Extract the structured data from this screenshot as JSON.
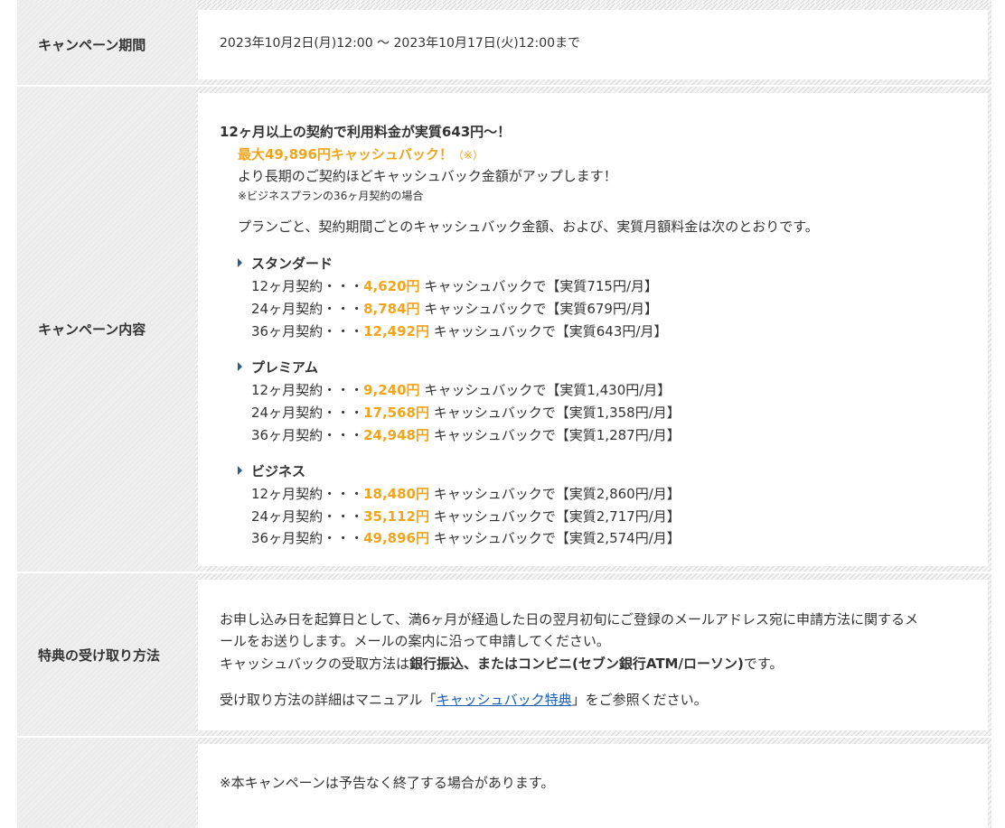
{
  "rows": [
    {
      "header": "キャンペーン期間",
      "period": "2023年10月2日(月)12:00 〜 2023年10月17日(火)12:00まで"
    },
    {
      "header": "キャンペーン内容",
      "headline": "12ヶ月以上の契約で利用料金が実質643円〜！",
      "max_cashback": "最大49,896円キャッシュバック！",
      "note_mark": "（※）",
      "longer_term": "より長期のご契約ほどキャッシュバック金額がアップします！",
      "footnote": "※ビジネスプランの36ヶ月契約の場合",
      "intro": "プランごと、契約期間ごとのキャッシュバック金額、および、実質月額料金は次のとおりです。",
      "plans": [
        {
          "name": "スタンダード",
          "rows": [
            {
              "term": "12ヶ月契約・・・",
              "amount": "4,620円",
              "suffix": " キャッシュバックで【実質715円/月】"
            },
            {
              "term": "24ヶ月契約・・・",
              "amount": "8,784円",
              "suffix": " キャッシュバックで【実質679円/月】"
            },
            {
              "term": "36ヶ月契約・・・",
              "amount": "12,492円",
              "suffix": " キャッシュバックで【実質643円/月】"
            }
          ]
        },
        {
          "name": "プレミアム",
          "rows": [
            {
              "term": "12ヶ月契約・・・",
              "amount": "9,240円",
              "suffix": " キャッシュバックで【実質1,430円/月】"
            },
            {
              "term": "24ヶ月契約・・・",
              "amount": "17,568円",
              "suffix": " キャッシュバックで【実質1,358円/月】"
            },
            {
              "term": "36ヶ月契約・・・",
              "amount": "24,948円",
              "suffix": " キャッシュバックで【実質1,287円/月】"
            }
          ]
        },
        {
          "name": "ビジネス",
          "rows": [
            {
              "term": "12ヶ月契約・・・",
              "amount": "18,480円",
              "suffix": " キャッシュバックで【実質2,860円/月】"
            },
            {
              "term": "24ヶ月契約・・・",
              "amount": "35,112円",
              "suffix": " キャッシュバックで【実質2,717円/月】"
            },
            {
              "term": "36ヶ月契約・・・",
              "amount": "49,896円",
              "suffix": " キャッシュバックで【実質2,574円/月】"
            }
          ]
        }
      ]
    },
    {
      "header": "特典の受け取り方法",
      "p1_line1": "お申し込み日を起算日として、満6ヶ月が経過した日の翌月初旬にご登録のメールアドレス宛に申請方法に関するメ",
      "p1_line2": "ールをお送りします。メールの案内に沿って申請してください。",
      "p2_pre": "キャッシュバックの受取方法は",
      "p2_bold": "銀行振込、またはコンビニ(セブン銀行ATM/ローソン)",
      "p2_post": "です。",
      "p3_pre": "受け取り方法の詳細はマニュアル「",
      "p3_link": "キャッシュバック特典",
      "p3_post": "」をご参照ください。"
    },
    {
      "header": "",
      "note": "※本キャンペーンは予告なく終了する場合があります。"
    }
  ]
}
